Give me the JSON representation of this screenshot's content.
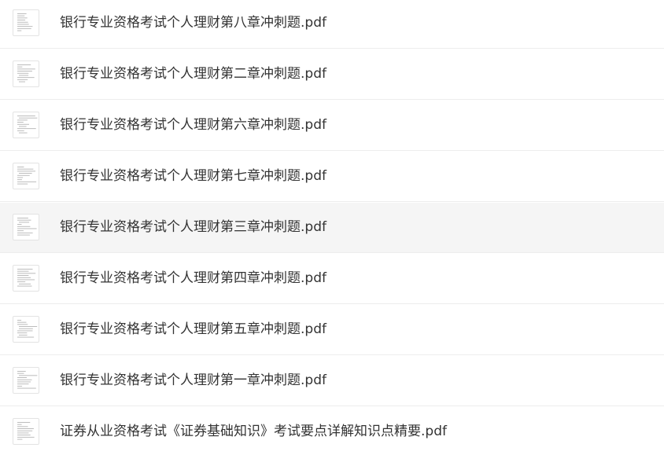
{
  "files": [
    {
      "name": "银行专业资格考试个人理财第八章冲刺题.pdf",
      "thumbnail_icon": "pdf-page-thumbnail-icon"
    },
    {
      "name": "银行专业资格考试个人理财第二章冲刺题.pdf",
      "thumbnail_icon": "pdf-page-thumbnail-icon"
    },
    {
      "name": "银行专业资格考试个人理财第六章冲刺题.pdf",
      "thumbnail_icon": "pdf-page-thumbnail-icon"
    },
    {
      "name": "银行专业资格考试个人理财第七章冲刺题.pdf",
      "thumbnail_icon": "pdf-page-thumbnail-icon"
    },
    {
      "name": "银行专业资格考试个人理财第三章冲刺题.pdf",
      "thumbnail_icon": "pdf-page-thumbnail-icon"
    },
    {
      "name": "银行专业资格考试个人理财第四章冲刺题.pdf",
      "thumbnail_icon": "pdf-page-thumbnail-icon"
    },
    {
      "name": "银行专业资格考试个人理财第五章冲刺题.pdf",
      "thumbnail_icon": "pdf-page-thumbnail-icon"
    },
    {
      "name": "银行专业资格考试个人理财第一章冲刺题.pdf",
      "thumbnail_icon": "pdf-page-thumbnail-icon"
    },
    {
      "name": "证券从业资格考试《证券基础知识》考试要点详解知识点精要.pdf",
      "thumbnail_icon": "pdf-page-thumbnail-icon"
    }
  ],
  "hovered_index": 4,
  "colors": {
    "text": "#333333",
    "row_hover": "#f5f5f5",
    "divider": "#ededed",
    "thumb_border": "#e3e3e3"
  }
}
